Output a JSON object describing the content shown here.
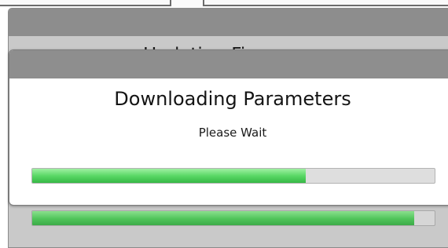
{
  "background_dialog": {
    "title": "Updating Firmware",
    "progress": 0.95
  },
  "dialog": {
    "title": "Downloading Parameters",
    "subtitle": "Please Wait",
    "progress": 0.68
  },
  "colors": {
    "titlebar": "#8e8e8e",
    "progress_fill": "#4fc45a",
    "progress_track": "#dedede",
    "dialog_background": "#ffffff",
    "background_dialog_body": "#c9c9c9"
  }
}
